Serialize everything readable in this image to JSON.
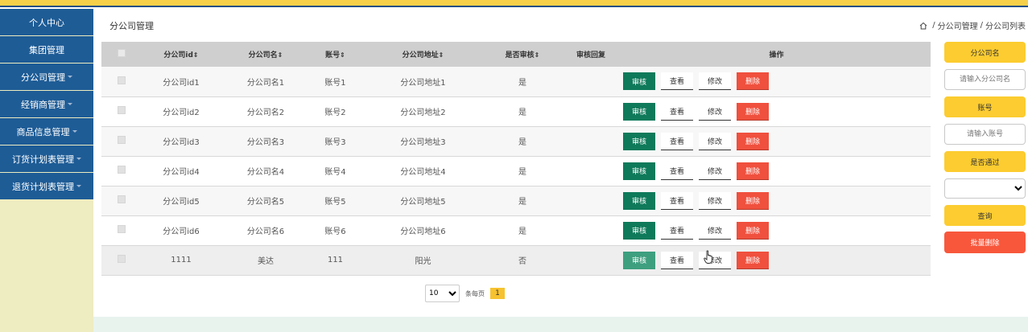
{
  "sidebar": {
    "items": [
      {
        "label": "个人中心",
        "has_caret": false
      },
      {
        "label": "集团管理",
        "has_caret": false
      },
      {
        "label": "分公司管理",
        "has_caret": true
      },
      {
        "label": "经销商管理",
        "has_caret": true
      },
      {
        "label": "商品信息管理",
        "has_caret": true
      },
      {
        "label": "订货计划表管理",
        "has_caret": true
      },
      {
        "label": "退货计划表管理",
        "has_caret": true
      }
    ]
  },
  "header": {
    "title": "分公司管理",
    "breadcrumb": [
      "分公司管理",
      "分公司列表"
    ],
    "breadcrumb_separator": "/"
  },
  "table": {
    "columns": [
      {
        "label": "分公司id",
        "sortable": true
      },
      {
        "label": "分公司名",
        "sortable": true
      },
      {
        "label": "账号",
        "sortable": true
      },
      {
        "label": "分公司地址",
        "sortable": true
      },
      {
        "label": "是否审核",
        "sortable": true
      },
      {
        "label": "审核回复",
        "sortable": false
      },
      {
        "label": "操作",
        "sortable": false
      }
    ],
    "sort_glyph": "⇕",
    "rows": [
      {
        "id": "分公司id1",
        "name": "分公司名1",
        "account": "账号1",
        "address": "分公司地址1",
        "approved": "是",
        "reply": ""
      },
      {
        "id": "分公司id2",
        "name": "分公司名2",
        "account": "账号2",
        "address": "分公司地址2",
        "approved": "是",
        "reply": ""
      },
      {
        "id": "分公司id3",
        "name": "分公司名3",
        "account": "账号3",
        "address": "分公司地址3",
        "approved": "是",
        "reply": ""
      },
      {
        "id": "分公司id4",
        "name": "分公司名4",
        "account": "账号4",
        "address": "分公司地址4",
        "approved": "是",
        "reply": ""
      },
      {
        "id": "分公司id5",
        "name": "分公司名5",
        "account": "账号5",
        "address": "分公司地址5",
        "approved": "是",
        "reply": ""
      },
      {
        "id": "分公司id6",
        "name": "分公司名6",
        "account": "账号6",
        "address": "分公司地址6",
        "approved": "是",
        "reply": ""
      },
      {
        "id": "1111",
        "name": "美达",
        "account": "111",
        "address": "阳光",
        "approved": "否",
        "reply": ""
      }
    ],
    "actions": {
      "audit": "审核",
      "view": "查看",
      "edit": "修改",
      "delete": "删除"
    }
  },
  "pagination": {
    "page_size": "10",
    "page_size_options": [
      "10"
    ],
    "per_page_label": "条每页",
    "current_page": "1"
  },
  "search": {
    "name_label": "分公司名",
    "name_placeholder": "请输入分公司名",
    "account_label": "账号",
    "account_placeholder": "请输入账号",
    "approved_label": "是否通过",
    "approved_value": "",
    "query_button": "查询",
    "bulk_delete_button": "批量删除"
  },
  "colors": {
    "accent_yellow": "#f7d04a",
    "sidebar_blue": "#1e5c96",
    "audit_green": "#0f7a5a",
    "delete_red": "#f0503e"
  }
}
